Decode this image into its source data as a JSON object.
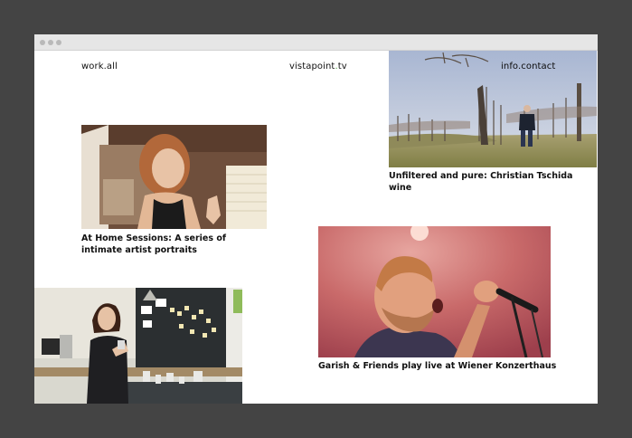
{
  "nav": {
    "work": "work.all",
    "logo_main": "vistapoint",
    "logo_dot": ".",
    "logo_tld": "tv",
    "contact": "info.contact"
  },
  "posts": [
    {
      "caption": "Unfiltered and pure: Christian Tschida wine"
    },
    {
      "caption": "At Home Sessions: A series of intimate artist portraits"
    },
    {
      "caption": "Garish & Friends play live at Wiener Konzerthaus"
    }
  ],
  "colors": {
    "backdrop": "#444444",
    "page": "#ffffff",
    "logo_accent": "#4caa3c"
  }
}
